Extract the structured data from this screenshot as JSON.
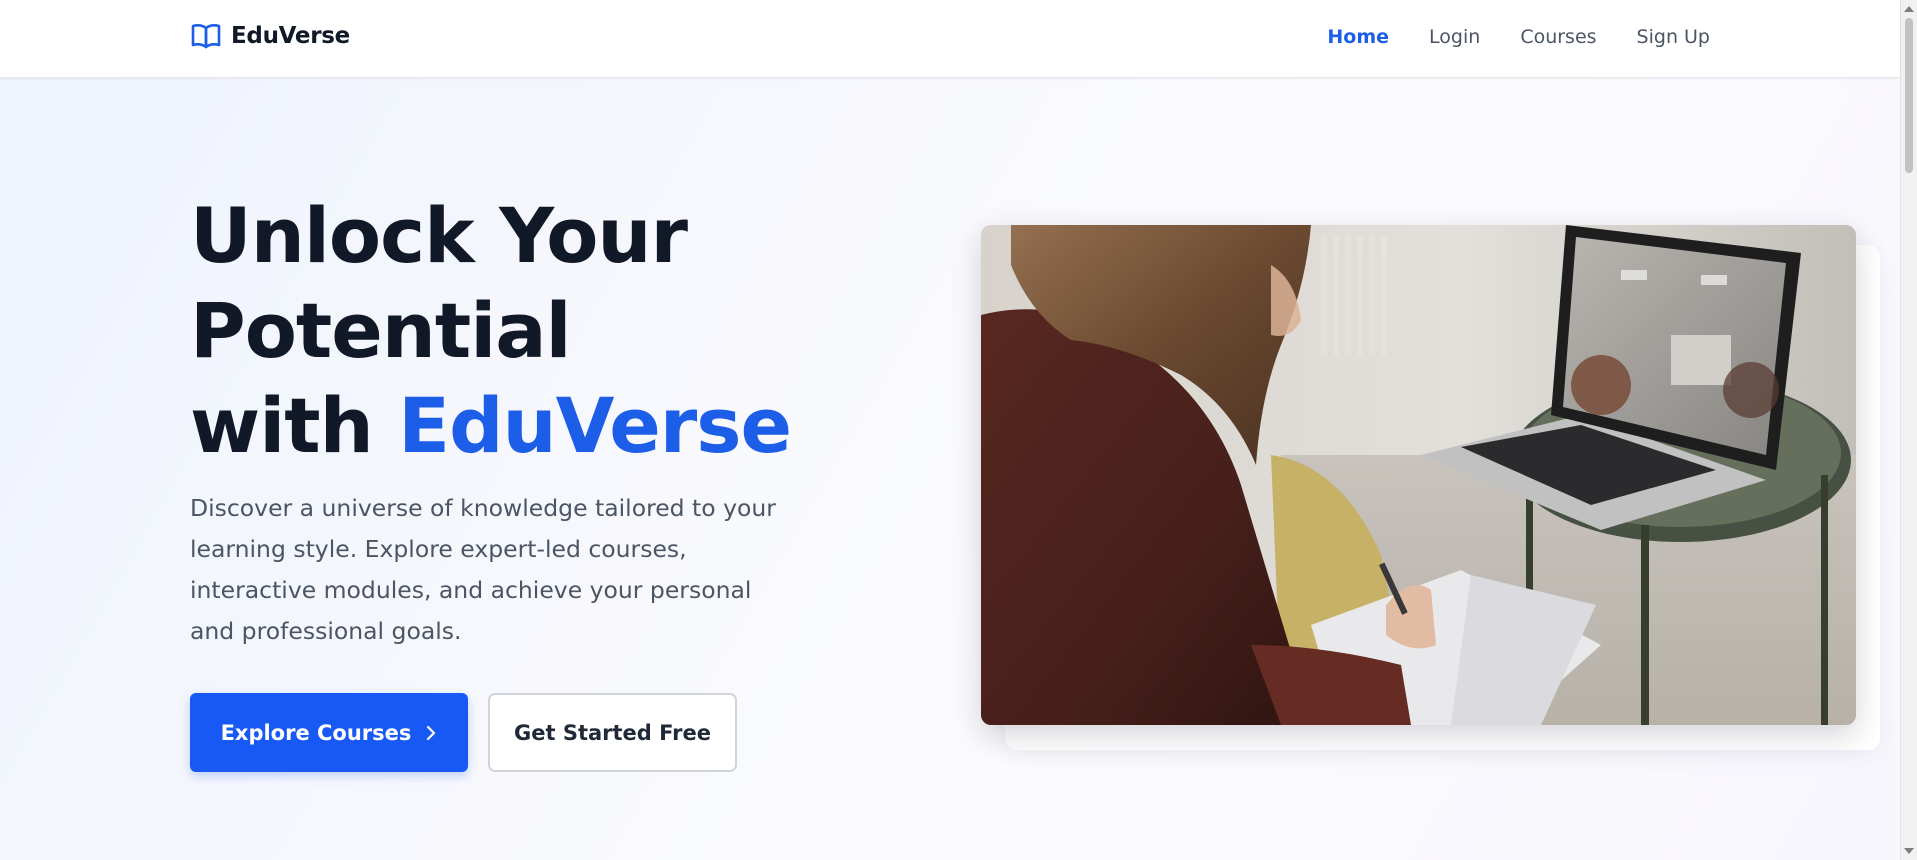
{
  "brand": {
    "name": "EduVerse",
    "icon": "open-book-icon",
    "accent_color": "#1d5ee8"
  },
  "nav": {
    "items": [
      {
        "label": "Home",
        "active": true
      },
      {
        "label": "Login",
        "active": false
      },
      {
        "label": "Courses",
        "active": false
      },
      {
        "label": "Sign Up",
        "active": false
      }
    ]
  },
  "hero": {
    "title_line1": "Unlock Your",
    "title_line2": "Potential",
    "title_line3_prefix": "with ",
    "title_line3_accent": "EduVerse",
    "description": "Discover a universe of knowledge tailored to your learning style. Explore expert-led courses, interactive modules, and achieve your personal and professional goals.",
    "primary_button": {
      "label": "Explore Courses",
      "icon": "chevron-right-icon",
      "color": "#1859f5"
    },
    "secondary_button": {
      "label": "Get Started Free"
    },
    "image": {
      "subject": "student-taking-notes-beside-laptop-photo"
    }
  }
}
